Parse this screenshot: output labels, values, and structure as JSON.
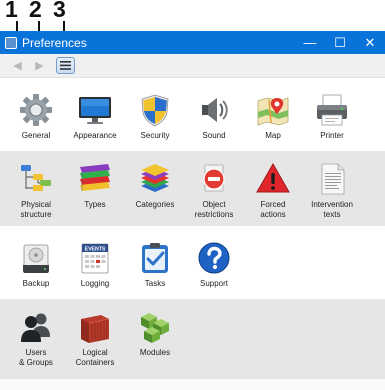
{
  "annotations": [
    "1",
    "2",
    "3"
  ],
  "window": {
    "title": "Preferences",
    "minimize_glyph": "—",
    "maximize_glyph": "☐",
    "close_glyph": "✕"
  },
  "toolbar": {
    "back_glyph": "◀",
    "forward_glyph": "▶",
    "show_all_icon": "list-icon"
  },
  "rows": [
    {
      "items": [
        {
          "label": "General",
          "icon": "gear-icon"
        },
        {
          "label": "Appearance",
          "icon": "monitor-icon"
        },
        {
          "label": "Security",
          "icon": "shield-icon"
        },
        {
          "label": "Sound",
          "icon": "speaker-icon"
        },
        {
          "label": "Map",
          "icon": "map-icon"
        },
        {
          "label": "Printer",
          "icon": "printer-icon"
        }
      ]
    },
    {
      "items": [
        {
          "label": "Physical\nstructure",
          "icon": "hierarchy-icon"
        },
        {
          "label": "Types",
          "icon": "stacked-bars-icon"
        },
        {
          "label": "Categories",
          "icon": "stacked-layers-icon"
        },
        {
          "label": "Object\nrestrictions",
          "icon": "no-entry-icon"
        },
        {
          "label": "Forced\nactions",
          "icon": "warning-icon"
        },
        {
          "label": "Intervention\ntexts",
          "icon": "document-icon"
        }
      ]
    },
    {
      "items": [
        {
          "label": "Backup",
          "icon": "drive-icon"
        },
        {
          "label": "Logging",
          "icon": "calendar-icon"
        },
        {
          "label": "Tasks",
          "icon": "clipboard-icon"
        },
        {
          "label": "Support",
          "icon": "help-icon"
        }
      ]
    },
    {
      "items": [
        {
          "label": "Users\n& Groups",
          "icon": "users-icon"
        },
        {
          "label": "Logical\nContainers",
          "icon": "container-icon"
        },
        {
          "label": "Modules",
          "icon": "cubes-icon"
        }
      ]
    }
  ],
  "calendar_icon_text": "EVENTS"
}
